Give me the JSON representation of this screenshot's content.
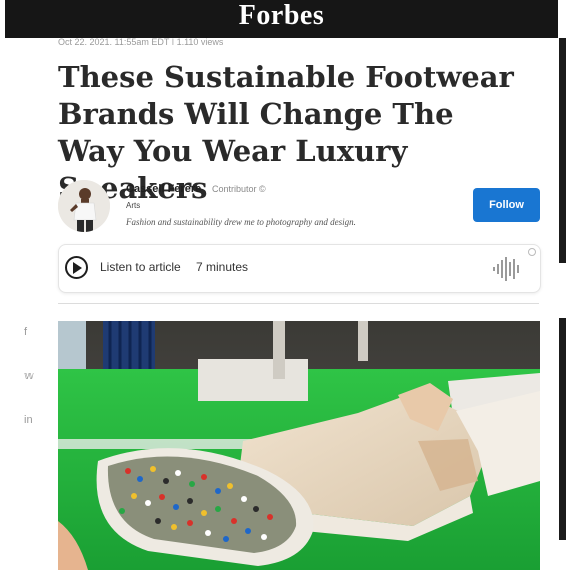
{
  "header": {
    "logo": "Forbes"
  },
  "article": {
    "meta": "Oct 22, 2021, 11:55am EDT | 1,110 views",
    "headline": "These Sustainable Footwear Brands Will Change The Way You Wear Luxury Sneakers"
  },
  "author": {
    "name": "Cassell Ferere",
    "role": "Contributor ©",
    "category": "Arts",
    "bio": "Fashion and sustainability drew me to photography and design.",
    "follow_label": "Follow"
  },
  "audio": {
    "label": "Listen to article",
    "duration": "7 minutes",
    "icons": [
      "play-icon",
      "waveform-icon"
    ]
  },
  "share": {
    "facebook": "f",
    "twitter": "𝕨",
    "linkedin": "in"
  },
  "colors": {
    "header_bg": "#161616",
    "follow_button": "#1976d2",
    "headline_text": "#2a2a2a",
    "image_green": "#22b53d"
  }
}
